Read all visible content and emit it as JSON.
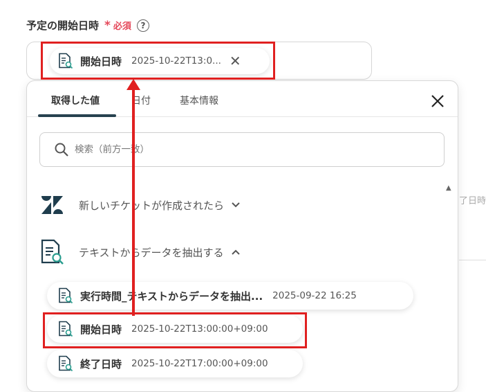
{
  "field": {
    "label": "予定の開始日時",
    "required_star": "*",
    "required_text": "必須",
    "help": "?"
  },
  "selected_chip": {
    "label": "開始日時",
    "value": "2025-10-22T13:0...",
    "close": "✕"
  },
  "tabs": [
    "取得した値",
    "日付",
    "基本情報"
  ],
  "search": {
    "placeholder": "検索（前方一致）"
  },
  "sections": [
    {
      "title": "新しいチケットが作成されたら",
      "icon": "zendesk-icon",
      "expanded": false
    },
    {
      "title": "テキストからデータを抽出する",
      "icon": "document-search-icon",
      "expanded": true
    }
  ],
  "items": [
    {
      "label": "実行時間_テキストからデータを抽出...",
      "value": "2025-09-22 16:25"
    },
    {
      "label": "開始日時",
      "value": "2025-10-22T13:00:00+09:00"
    },
    {
      "label": "終了日時",
      "value": "2025-10-22T17:00:00+09:00"
    }
  ],
  "background_text": "了日時",
  "colors": {
    "accent": "#27424f",
    "highlight": "#e02020",
    "required": "#e5485a"
  }
}
